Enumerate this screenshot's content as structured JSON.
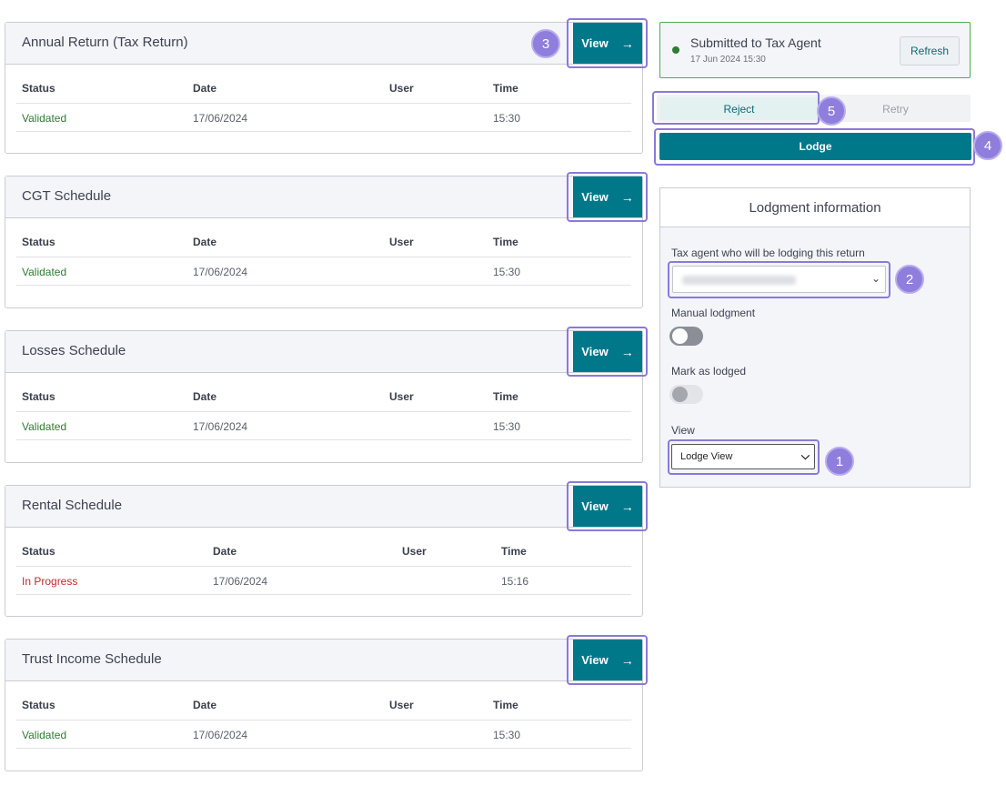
{
  "schedules": [
    {
      "title": "Annual Return (Tax Return)",
      "view_label": "View",
      "headers": [
        "Status",
        "Date",
        "User",
        "Time"
      ],
      "row": {
        "status": "Validated",
        "date": "17/06/2024",
        "user": "",
        "time": "15:30"
      }
    },
    {
      "title": "CGT Schedule",
      "view_label": "View",
      "headers": [
        "Status",
        "Date",
        "User",
        "Time"
      ],
      "row": {
        "status": "Validated",
        "date": "17/06/2024",
        "user": "",
        "time": "15:30"
      }
    },
    {
      "title": "Losses Schedule",
      "view_label": "View",
      "headers": [
        "Status",
        "Date",
        "User",
        "Time"
      ],
      "row": {
        "status": "Validated",
        "date": "17/06/2024",
        "user": "",
        "time": "15:30"
      }
    },
    {
      "title": "Rental Schedule",
      "view_label": "View",
      "headers": [
        "Status",
        "Date",
        "User",
        "Time"
      ],
      "row": {
        "status": "In Progress",
        "date": "17/06/2024",
        "user": "",
        "time": "15:16"
      }
    },
    {
      "title": "Trust Income Schedule",
      "view_label": "View",
      "headers": [
        "Status",
        "Date",
        "User",
        "Time"
      ],
      "row": {
        "status": "Validated",
        "date": "17/06/2024",
        "user": "",
        "time": "15:30"
      }
    }
  ],
  "arrow_glyph": "→",
  "status_panel": {
    "title": "Submitted to Tax Agent",
    "timestamp": "17 Jun 2024 15:30",
    "refresh_label": "Refresh"
  },
  "actions": {
    "reject_label": "Reject",
    "retry_label": "Retry",
    "lodge_label": "Lodge"
  },
  "lodgment": {
    "heading": "Lodgment information",
    "agent_label": "Tax agent who will be lodging this return",
    "agent_value": "",
    "manual_label": "Manual lodgment",
    "manual_on": false,
    "mark_label": "Mark as lodged",
    "mark_enabled": false,
    "view_label": "View",
    "view_value": "Lodge View"
  },
  "callouts": [
    "1",
    "2",
    "3",
    "4",
    "5"
  ],
  "colors": {
    "primary": "#00788a",
    "validated": "#2e7d32",
    "in_progress": "#c62828",
    "highlight": "#8b79d9"
  }
}
